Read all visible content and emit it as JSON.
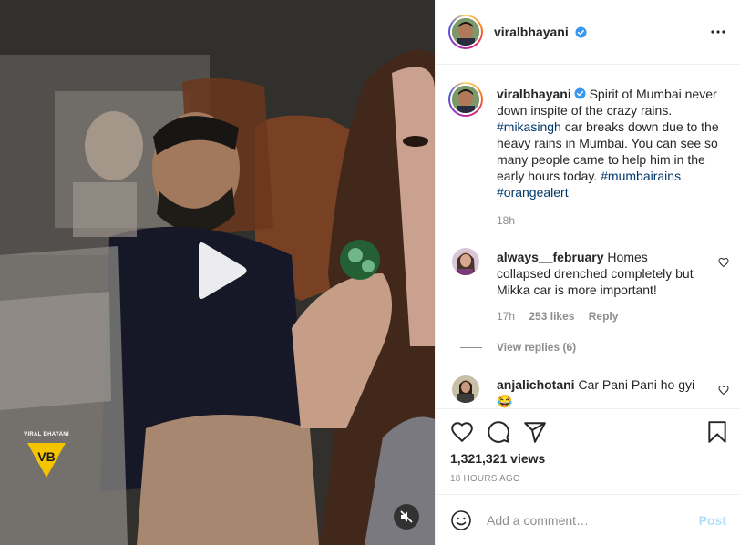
{
  "post": {
    "username": "viralbhayani",
    "caption": {
      "part1": " Spirit of Mumbai never down inspite of the crazy rains. ",
      "tag1": "#mikasingh",
      "part2": " car breaks down due to the heavy rains in Mumbai. You can see so many people came to help him in the early hours today. ",
      "tag2": "#mumbairains",
      "tag3": "#orangealert"
    },
    "caption_time": "18h",
    "views": "1,321,321 views",
    "time_ago": "18 HOURS AGO"
  },
  "video": {
    "watermark": "VIRAL BHAYANI",
    "state": "paused",
    "muted": true
  },
  "comments": [
    {
      "username": "always__february",
      "text": " Homes collapsed drenched completely but Mikka car is more important!",
      "time": "17h",
      "likes": "253 likes",
      "reply": "Reply",
      "view_replies": "View replies (6)"
    },
    {
      "username": "anjalichotani",
      "text": " Car Pani Pani ho gyi",
      "emoji": "😂"
    }
  ],
  "add_comment": {
    "placeholder": "Add a comment…",
    "post_label": "Post"
  },
  "icons": {
    "like": "heart-icon",
    "comment": "comment-icon",
    "share": "paper-plane-icon",
    "save": "bookmark-icon",
    "more": "more-options-icon",
    "play": "play-icon",
    "mute": "muted-speaker-icon",
    "verified": "verified-badge-icon",
    "emoji": "emoji-icon"
  },
  "colors": {
    "link": "#00376b",
    "verified": "#3897f0",
    "muted_text": "#8e8e8e",
    "post_button_disabled": "#b2dffc"
  }
}
